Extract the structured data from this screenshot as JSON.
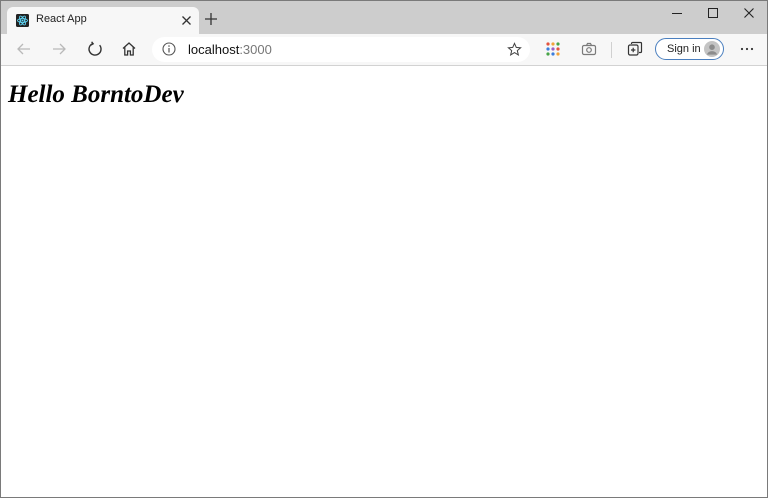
{
  "browser": {
    "tab": {
      "title": "React App",
      "favicon": "react-logo-icon",
      "close_icon": "close-icon"
    },
    "new_tab_icon": "plus-icon",
    "window_controls": [
      "minimize-icon",
      "maximize-icon",
      "close-icon"
    ],
    "toolbar": {
      "back_icon": "arrow-left-icon",
      "forward_icon": "arrow-right-icon",
      "refresh_icon": "refresh-icon",
      "home_icon": "home-icon",
      "address": {
        "host": "localhost",
        "port": ":3000",
        "info_icon": "info-icon",
        "favorite_icon": "star-icon"
      },
      "apps_icon": "apps-grid-icon",
      "screenshot_icon": "camera-icon",
      "collections_icon": "collections-icon",
      "signin_label": "Sign in",
      "profile_icon": "avatar-icon",
      "menu_icon": "more-icon"
    },
    "colors": {
      "tabstrip": "#cdcdcd",
      "toolbar": "#f7f7f7",
      "react_accent": "#61dafb",
      "signin_border": "#4a7fbf"
    }
  },
  "page": {
    "heading": "Hello BorntoDev"
  }
}
